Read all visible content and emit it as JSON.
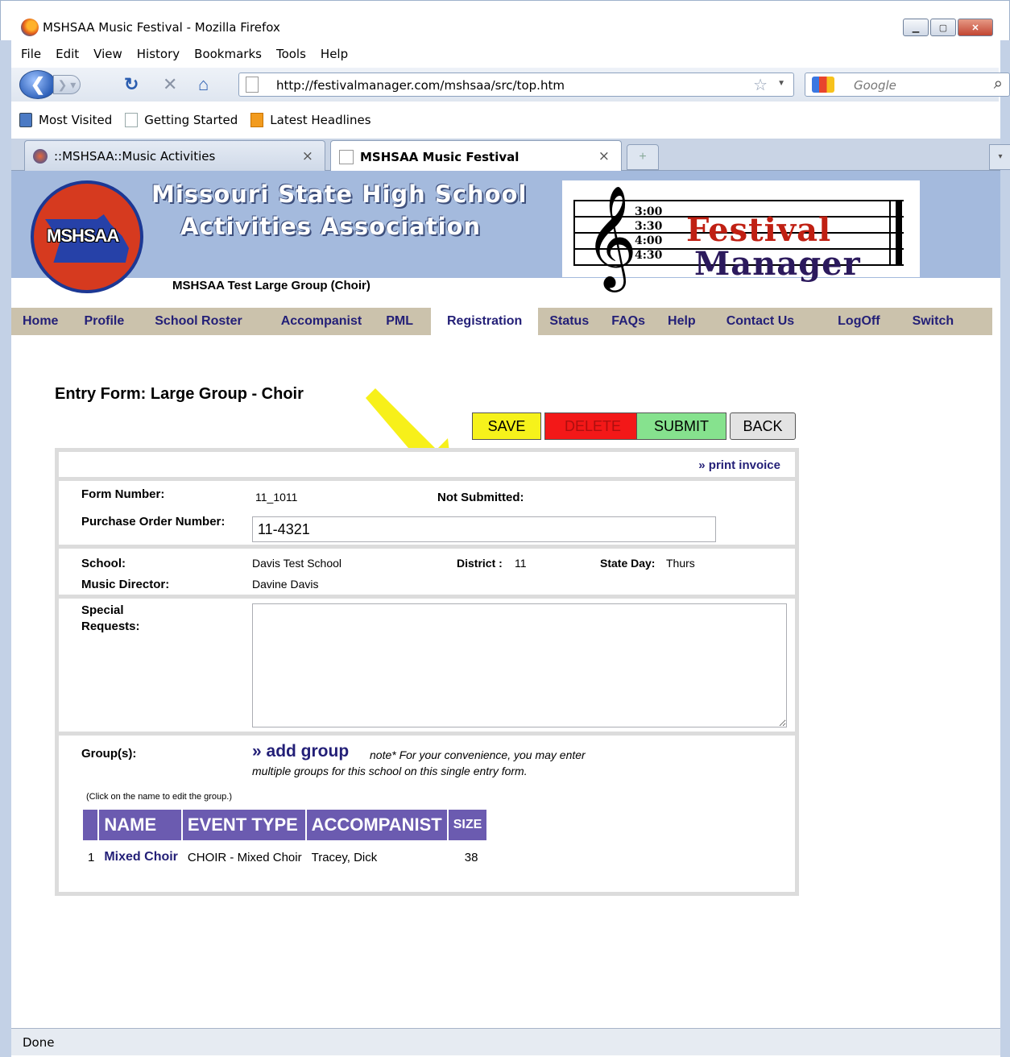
{
  "window": {
    "title": "MSHSAA Music Festival - Mozilla Firefox",
    "minimize": "▁",
    "maximize": "▢",
    "close": "✕"
  },
  "menu": [
    "File",
    "Edit",
    "View",
    "History",
    "Bookmarks",
    "Tools",
    "Help"
  ],
  "toolbar": {
    "url": "http://festivalmanager.com/mshsaa/src/top.htm",
    "search_placeholder": "Google"
  },
  "bookmarks": [
    "Most Visited",
    "Getting Started",
    "Latest Headlines"
  ],
  "tabs": [
    {
      "label": "::MSHSAA::Music Activities",
      "active": false
    },
    {
      "label": "MSHSAA Music Festival",
      "active": true
    }
  ],
  "banner": {
    "logo_text": "MSHSAA",
    "org_line1": "Missouri State High School",
    "org_line2": "Activities Association",
    "times": [
      "3:00",
      "3:30",
      "4:00",
      "4:30"
    ],
    "product_line1": "Festival",
    "product_line2": "Manager",
    "group_name": "MSHSAA Test Large Group (Choir)"
  },
  "site_nav": {
    "items": [
      "Home",
      "Profile",
      "School Roster",
      "Accompanist",
      "PML",
      "Registration",
      "Status",
      "FAQs",
      "Help",
      "Contact Us",
      "LogOff",
      "Switch"
    ],
    "active": "Registration"
  },
  "form": {
    "title": "Entry Form: Large Group - Choir",
    "buttons": {
      "save": "SAVE",
      "delete": "DELETE",
      "submit": "SUBMIT",
      "back": "BACK"
    },
    "print_invoice": "» print invoice",
    "form_number_label": "Form Number:",
    "form_number": "11_1011",
    "status": "Not Submitted:",
    "po_label": "Purchase Order Number:",
    "po_value": "11-4321",
    "school_label": "School:",
    "school": "Davis Test School",
    "district_label": "District :",
    "district": "11",
    "state_day_label": "State Day:",
    "state_day": "Thurs",
    "director_label": "Music Director:",
    "director": "Davine Davis",
    "special_label_1": "Special",
    "special_label_2": "Requests:",
    "special_value": "",
    "groups_label": "Group(s):",
    "add_group": "» add group",
    "note_line1": "note* For your convenience, you may enter",
    "note_line2": "multiple groups for this school on this single entry form.",
    "click_note": "(Click on the name to edit the group.)",
    "table_headers": [
      "NAME",
      "EVENT TYPE",
      "ACCOMPANIST",
      "SIZE"
    ],
    "groups": [
      {
        "num": "1",
        "name": "Mixed Choir",
        "event": "CHOIR - Mixed Choir",
        "accompanist": "Tracey, Dick",
        "size": "38"
      }
    ]
  },
  "status_bar": "Done",
  "colors": {
    "banner_bg": "#a4badd",
    "nav_bg": "#cbc2ac",
    "link": "#231f77",
    "table_header": "#6b5bb0",
    "arrow": "#f7f01a"
  }
}
